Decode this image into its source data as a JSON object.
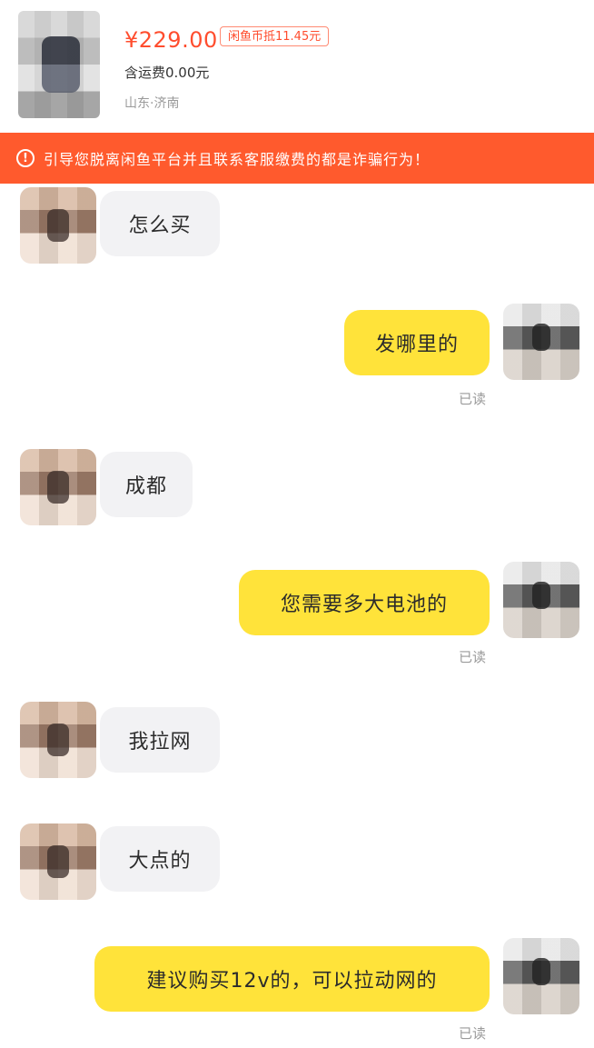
{
  "header": {
    "price": "¥229.00",
    "coin_badge": "闲鱼币抵11.45元",
    "shipping": "含运费0.00元",
    "location": "山东·济南"
  },
  "warning": {
    "icon": "!",
    "text": "引导您脱离闲鱼平台并且联系客服缴费的都是诈骗行为！"
  },
  "messages": [
    {
      "side": "left",
      "text": "怎么买"
    },
    {
      "side": "right",
      "text": "发哪里的",
      "status": "已读"
    },
    {
      "side": "left",
      "text": "成都"
    },
    {
      "side": "right",
      "text": "您需要多大电池的",
      "status": "已读"
    },
    {
      "side": "left",
      "text": "我拉网"
    },
    {
      "side": "left",
      "text": "大点的"
    },
    {
      "side": "right",
      "text": "建议购买12v的，可以拉动网的",
      "status": "已读"
    }
  ]
}
